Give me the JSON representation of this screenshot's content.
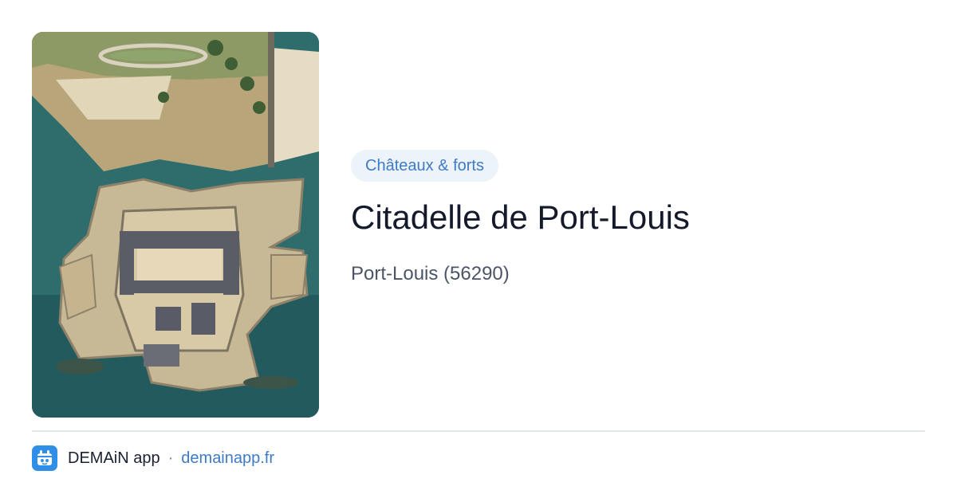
{
  "category": "Châteaux & forts",
  "title": "Citadelle de Port-Louis",
  "location": "Port-Louis (56290)",
  "footer": {
    "brand": "DEMAiN app",
    "separator": "·",
    "site": "demainapp.fr",
    "logo_icon": "demain-app-logo-icon"
  },
  "colors": {
    "chip_bg": "#edf3fb",
    "accent": "#3e7bc6",
    "title": "#141a2b",
    "subtitle": "#4b5566"
  }
}
